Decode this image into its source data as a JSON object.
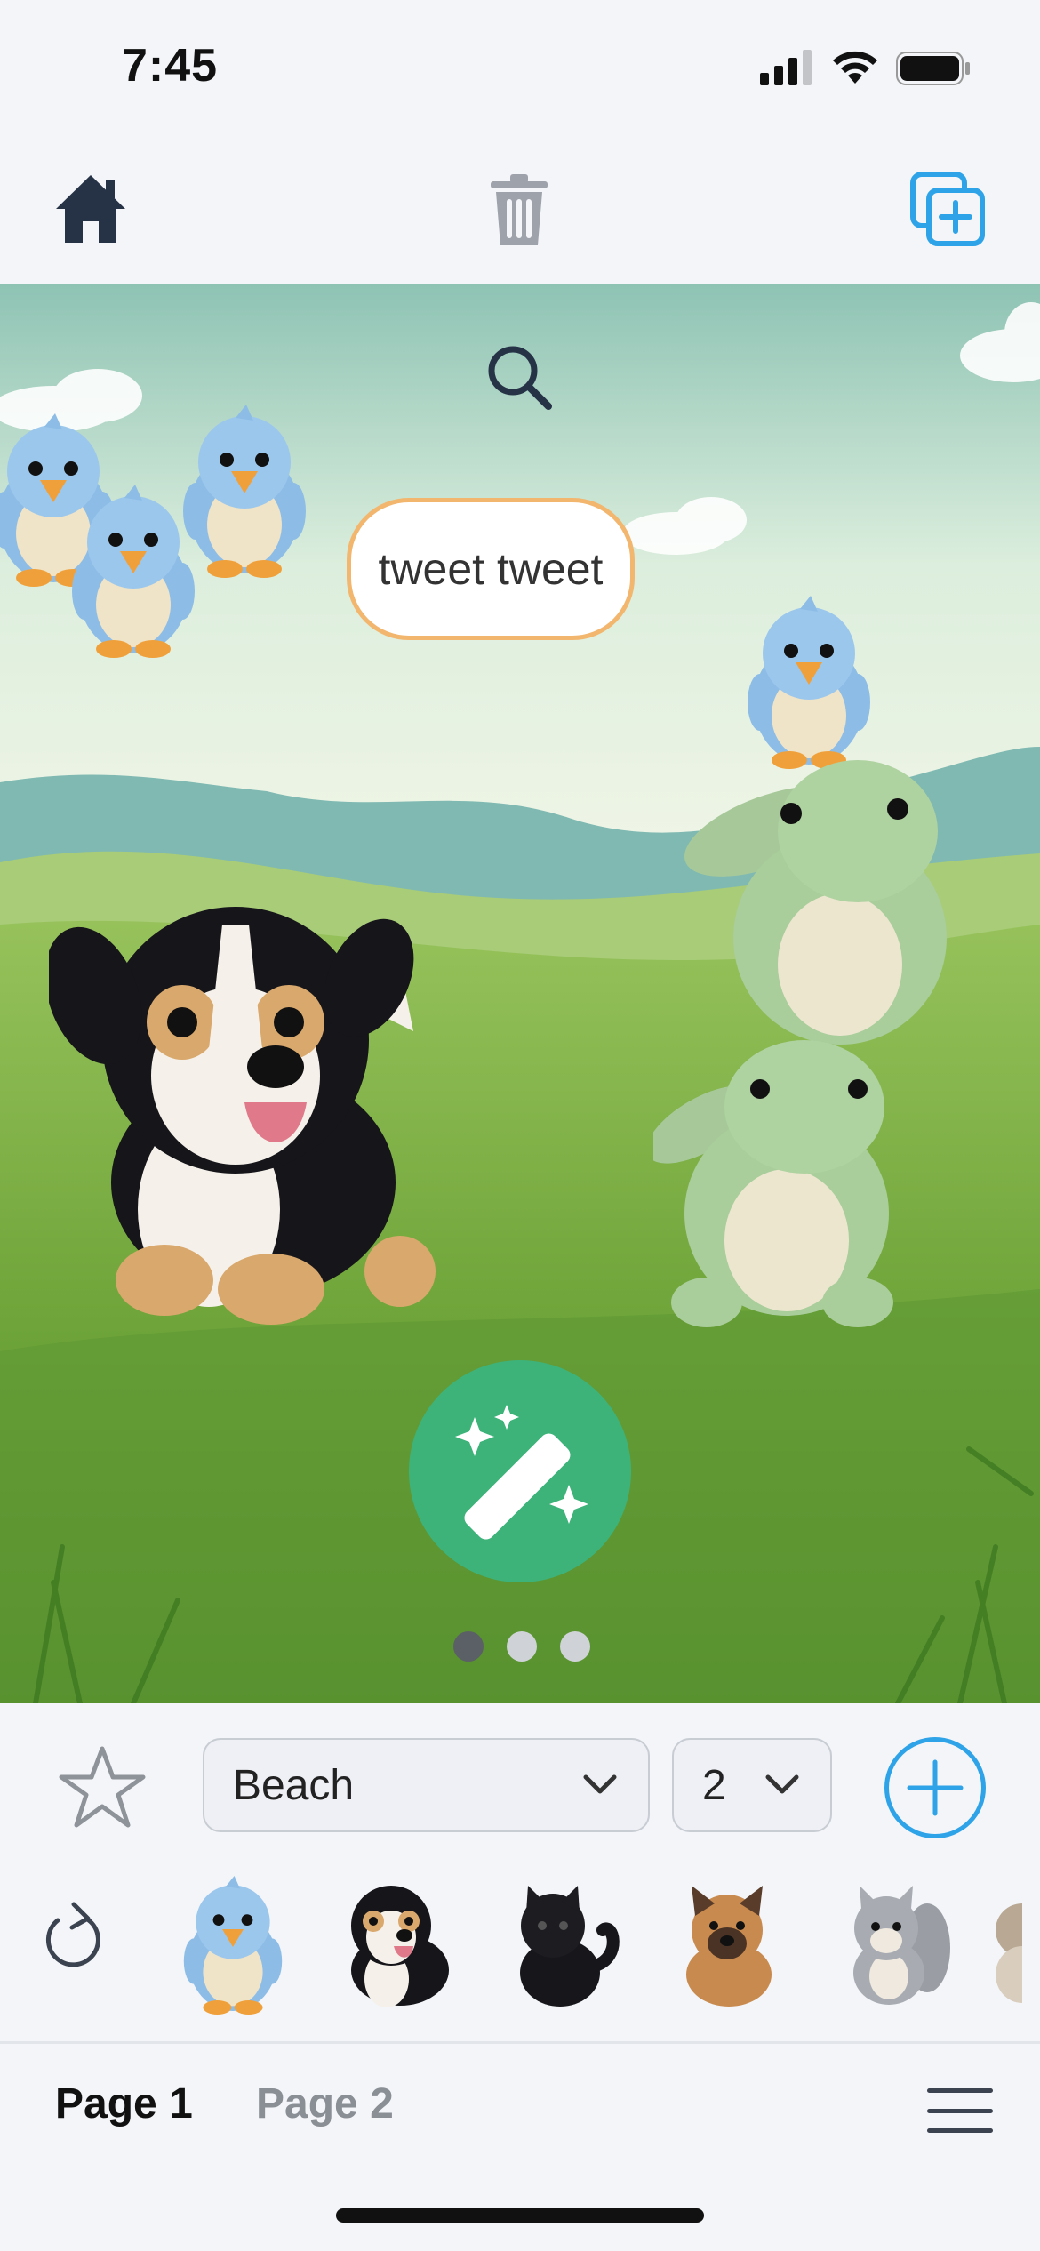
{
  "status_bar": {
    "time": "7:45",
    "icons": [
      "signal-icon",
      "wifi-icon",
      "battery-icon"
    ]
  },
  "toolbar": {
    "icons": [
      "home-icon",
      "trash-icon",
      "duplicate-add-icon"
    ]
  },
  "scene": {
    "speech_bubble": "tweet tweet",
    "plush_characters": [
      "bird",
      "bird",
      "bird",
      "bird",
      "puppy",
      "dinosaur",
      "dinosaur"
    ],
    "pager": {
      "pages": 3,
      "current": 1
    },
    "colors": {
      "magic_button": "#3db37a",
      "bubble_border": "#f2b66e"
    }
  },
  "controls": {
    "background_select": {
      "value": "Beach"
    },
    "count_select": {
      "value": "2"
    },
    "tray_items": [
      "bird",
      "puppy",
      "black-cat",
      "shepherd-dog",
      "squirrel",
      "more"
    ],
    "colors": {
      "accent": "#2fa3e8"
    }
  },
  "tabs": [
    {
      "label": "Page 1",
      "active": true
    },
    {
      "label": "Page 2",
      "active": false
    }
  ]
}
